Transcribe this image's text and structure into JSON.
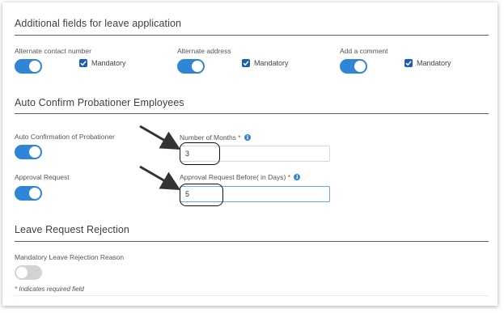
{
  "section1": {
    "title": "Additional fields for leave application",
    "fields": [
      {
        "label": "Alternate contact number",
        "toggle_on": true,
        "mandatory_label": "Mandatory",
        "mandatory_checked": true
      },
      {
        "label": "Alternate address",
        "toggle_on": true,
        "mandatory_label": "Mandatory",
        "mandatory_checked": true
      },
      {
        "label": "Add a comment",
        "toggle_on": true,
        "mandatory_label": "Mandatory",
        "mandatory_checked": true
      }
    ]
  },
  "section2": {
    "title": "Auto Confirm Probationer Employees",
    "auto_confirm_label": "Auto Confirmation of Probationer",
    "auto_confirm_on": true,
    "approval_request_label": "Approval Request",
    "approval_request_on": true,
    "months_label": "Number of Months",
    "months_required": "*",
    "months_value": "3",
    "days_label": "Approval Request Before( in Days)",
    "days_required": "*",
    "days_value": "5"
  },
  "section3": {
    "title": "Leave Request Rejection",
    "reason_label": "Mandatory Leave Rejection Reason",
    "reason_on": false,
    "note_star": "*",
    "note_text": "Indicates required field"
  },
  "icons": {
    "info": "info-icon",
    "check": "check-icon",
    "arrow": "annotation-arrow"
  },
  "colors": {
    "accent": "#2f86d6",
    "checkbox": "#1f5fb3",
    "required": "#d9332b"
  }
}
